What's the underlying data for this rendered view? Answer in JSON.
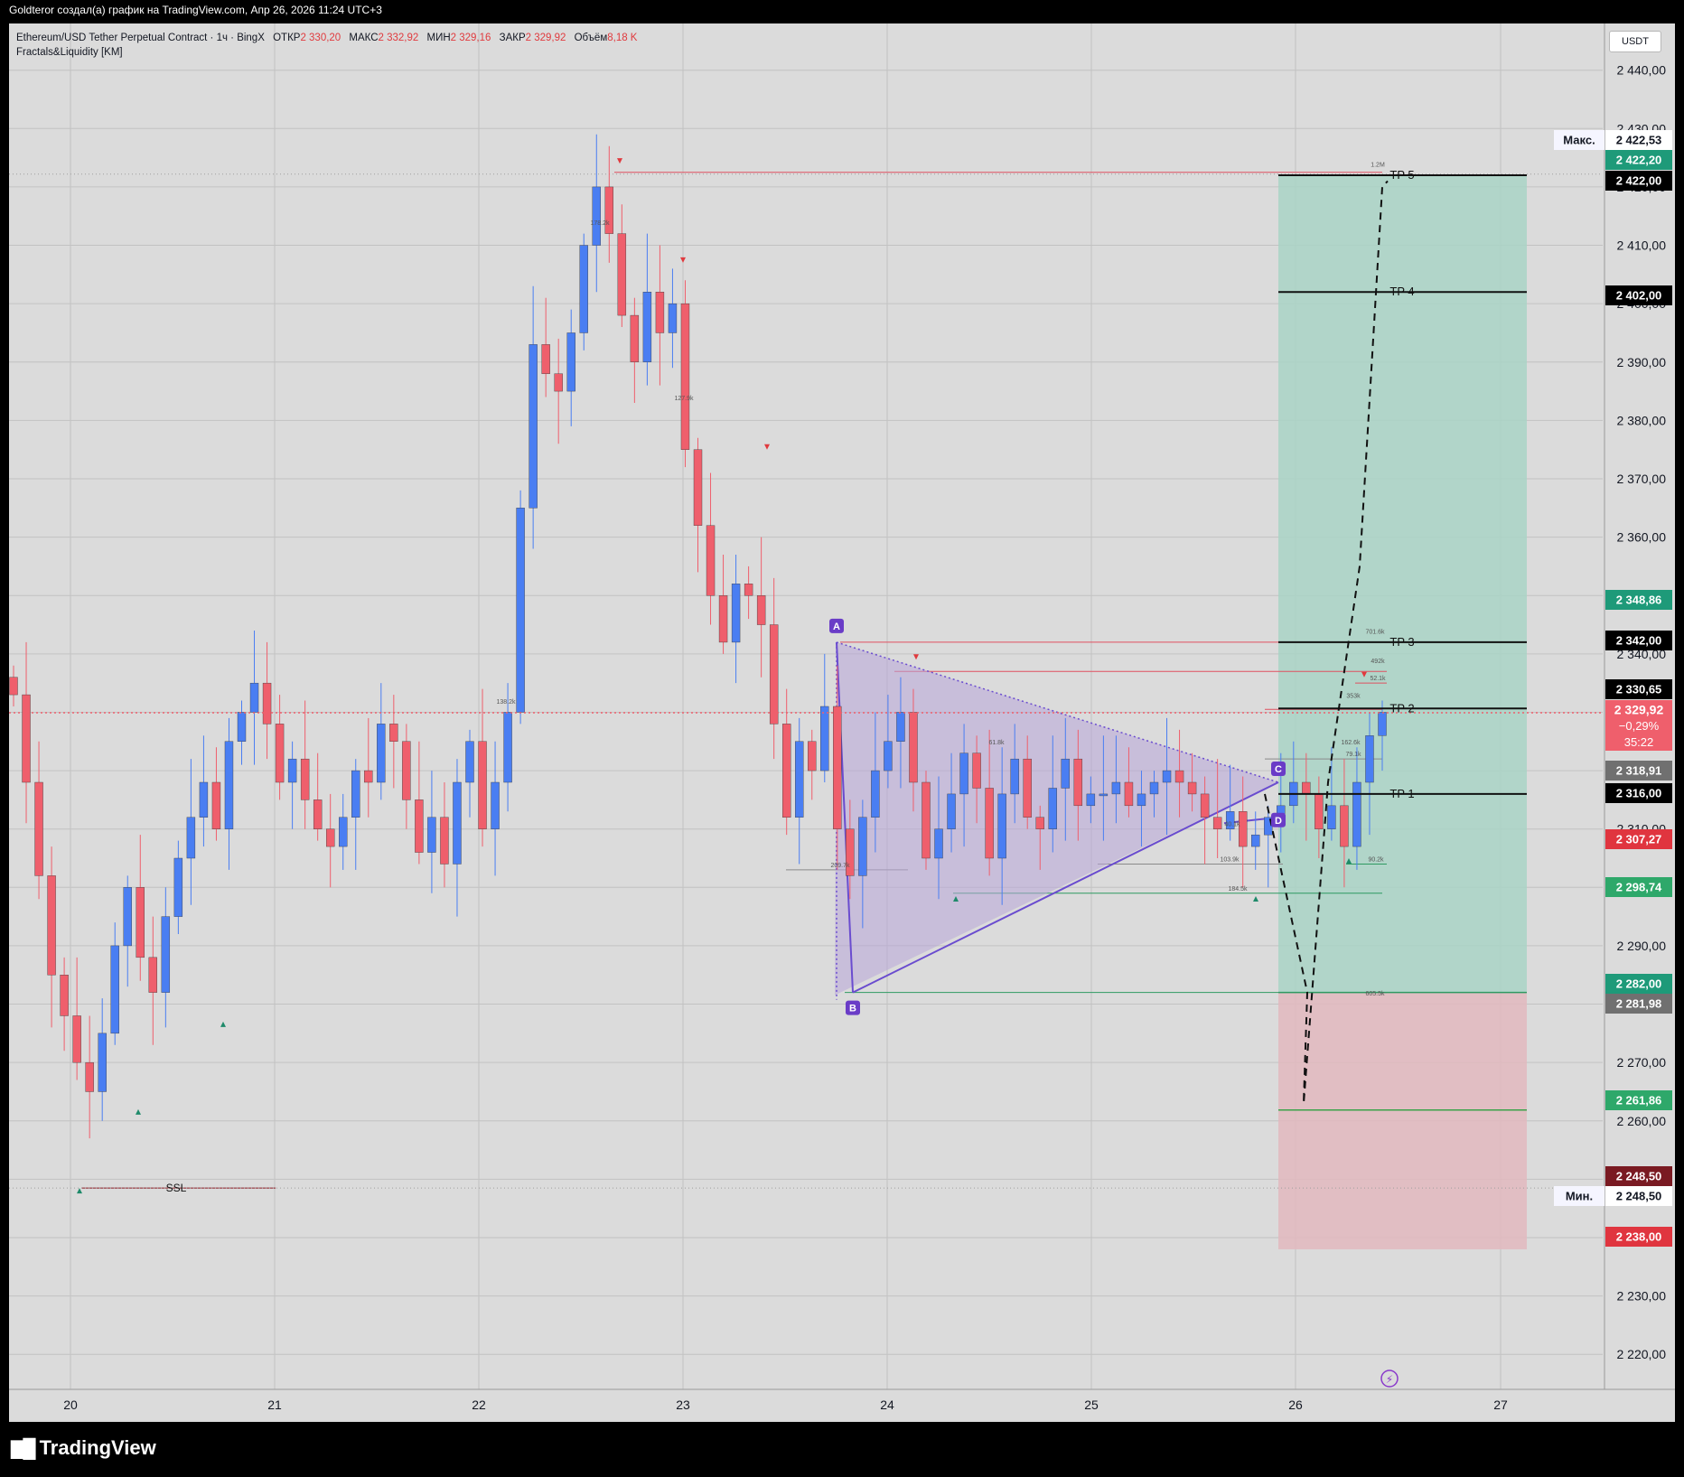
{
  "header": {
    "title": "Goldteror создал(а) график на TradingView.com, Апр 26, 2026 11:24 UTC+3"
  },
  "legend": {
    "symbol": "Ethereum/USD Tether Perpetual Contract · 1ч · BingX",
    "open_label": "ОТКР",
    "open": "2 330,20",
    "high_label": "МАКС",
    "high": "2 332,92",
    "low_label": "МИН",
    "low": "2 329,16",
    "close_label": "ЗАКР",
    "close": "2 329,92",
    "volume_label": "Объём",
    "volume": "8,18 K",
    "indicator": "Fractals&Liquidity [KM]"
  },
  "currency_button": "USDT",
  "branding": {
    "logo_text": "TradingView"
  },
  "colors": {
    "up": "#4a7ef2",
    "down": "#ef5f6c",
    "background": "#dbdbdb",
    "tp_zone": "#a9d4c6",
    "sl_zone": "#e2b8be",
    "triangle": "#b8a6d8",
    "pattern_line": "#6a4ccf"
  },
  "chart_data": {
    "type": "candlestick",
    "symbol": "ETHUSDT.P",
    "timeframe": "1h",
    "x_tick_labels": [
      "20",
      "21",
      "22",
      "23",
      "24",
      "25",
      "26",
      "27"
    ],
    "y_tick_labels": [
      "2 220,00",
      "2 230,00",
      "2 240,00",
      "2 250,00",
      "2 260,00",
      "2 270,00",
      "2 280,00",
      "2 290,00",
      "2 300,00",
      "2 310,00",
      "2 320,00",
      "2 330,00",
      "2 340,00",
      "2 350,00",
      "2 360,00",
      "2 370,00",
      "2 380,00",
      "2 390,00",
      "2 400,00",
      "2 410,00",
      "2 420,00",
      "2 430,00",
      "2 440,00"
    ],
    "ylim": [
      2214,
      2448
    ],
    "grid": true,
    "candles_close_path": [
      2333,
      2318,
      2302,
      2285,
      2278,
      2270,
      2265,
      2275,
      2290,
      2300,
      2288,
      2282,
      2295,
      2305,
      2312,
      2318,
      2310,
      2325,
      2330,
      2335,
      2328,
      2318,
      2322,
      2315,
      2310,
      2307,
      2312,
      2320,
      2318,
      2328,
      2325,
      2315,
      2306,
      2312,
      2304,
      2318,
      2325,
      2310,
      2318,
      2330,
      2365,
      2393,
      2388,
      2385,
      2395,
      2410,
      2420,
      2412,
      2398,
      2390,
      2402,
      2395,
      2400,
      2375,
      2362,
      2350,
      2342,
      2352,
      2350,
      2345,
      2328,
      2312,
      2325,
      2320,
      2331,
      2310,
      2302,
      2312,
      2320,
      2325,
      2330,
      2318,
      2305,
      2310,
      2316,
      2323,
      2317,
      2305,
      2316,
      2322,
      2312,
      2310,
      2317,
      2322,
      2314,
      2316,
      2316,
      2318,
      2314,
      2316,
      2318,
      2320,
      2318,
      2316,
      2312,
      2310,
      2313,
      2307,
      2309,
      2312,
      2314,
      2318,
      2316,
      2310,
      2314,
      2307,
      2318,
      2326,
      2330
    ],
    "price_axis_labels": [
      {
        "label": "Макс.",
        "value": "2 422,53"
      },
      {
        "value": "2 422,20"
      },
      {
        "value": "2 422,00"
      },
      {
        "value": "2 402,00"
      },
      {
        "value": "2 348,86"
      },
      {
        "value": "2 342,00"
      },
      {
        "value": "2 330,65"
      },
      {
        "value": "2 329,92",
        "change": "−0,29%",
        "countdown": "35:22"
      },
      {
        "value": "2 318,91"
      },
      {
        "value": "2 316,00"
      },
      {
        "value": "2 307,27"
      },
      {
        "value": "2 298,74"
      },
      {
        "value": "2 282,00"
      },
      {
        "value": "2 281,98"
      },
      {
        "value": "2 261,86"
      },
      {
        "value": "2 248,50"
      },
      {
        "label": "Мин.",
        "value": "2 248,50"
      },
      {
        "value": "2 238,00"
      }
    ],
    "take_profits": [
      {
        "name": "TP 1",
        "price": 2316.0
      },
      {
        "name": "TP 2",
        "price": 2330.65
      },
      {
        "name": "TP 3",
        "price": 2342.0
      },
      {
        "name": "TP 4",
        "price": 2402.0
      },
      {
        "name": "TP 5",
        "price": 2422.0
      }
    ],
    "entry_price": 2282.0,
    "stop_loss": 2238.0,
    "pattern_points": [
      {
        "label": "A",
        "price": 2342.0
      },
      {
        "label": "B",
        "price": 2282.0
      },
      {
        "label": "C",
        "price": 2318.0
      },
      {
        "label": "D",
        "price": 2312.0
      }
    ],
    "liquidity_labels": [
      {
        "text": "SSL",
        "price": 2248.5
      },
      {
        "text": "178.2k",
        "price": 2413.0
      },
      {
        "text": "127.9k",
        "price": 2383.0
      },
      {
        "text": "138.2k",
        "price": 2331.0
      },
      {
        "text": "1.2M",
        "price": 2423.0
      },
      {
        "text": "701.6k",
        "price": 2343.0
      },
      {
        "text": "492k",
        "price": 2338.0
      },
      {
        "text": "52.1k",
        "price": 2335.0
      },
      {
        "text": "353k",
        "price": 2332.0
      },
      {
        "text": "162.6k",
        "price": 2324.0
      },
      {
        "text": "79.1k",
        "price": 2322.0
      },
      {
        "text": "61.8k",
        "price": 2324.0
      },
      {
        "text": "40.1k",
        "price": 2310.0
      },
      {
        "text": "103.9k",
        "price": 2304.0
      },
      {
        "text": "184.5k",
        "price": 2299.0
      },
      {
        "text": "209.7k",
        "price": 2303.0
      },
      {
        "text": "90.2k",
        "price": 2304.0
      },
      {
        "text": "605.5k",
        "price": 2281.0
      }
    ]
  }
}
